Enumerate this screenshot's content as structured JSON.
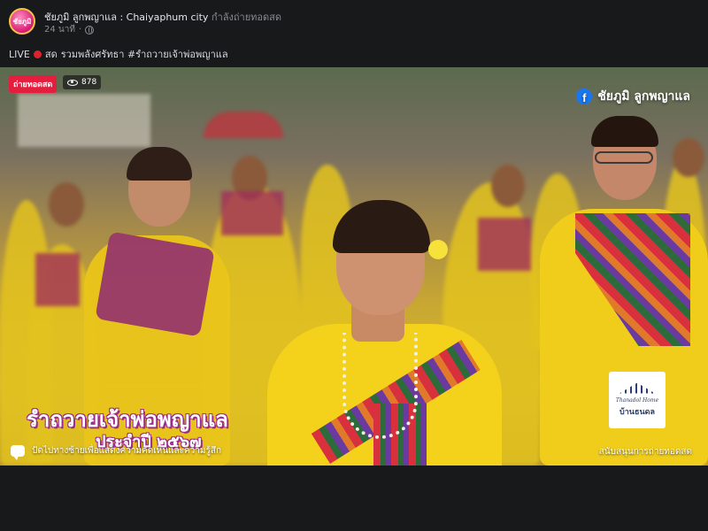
{
  "header": {
    "avatar_text": "ชัยภูมิ",
    "page_name": "ชัยภูมิ ลูกพญาแล : Chaiyaphum city",
    "status": "กำลังถ่ายทอดสด",
    "time": "24 นาที",
    "privacy_icon": "globe-icon"
  },
  "caption": {
    "live_label": "LIVE",
    "live_word": "สด",
    "text": "รวมพลังศรัทธา #รำถวายเจ้าพ่อพญาแล"
  },
  "video": {
    "live_badge": "ถ่ายทอดสด",
    "viewer_count": "878",
    "viewer_icon": "eye-icon",
    "fb_icon": "facebook-icon",
    "page_watermark": "ชัยภูมิ ลูกพญาแล",
    "title_line1": "รำถวายเจ้าพ่อพญาแล",
    "title_line2": "ประจำปี ๒๕๖๗",
    "comment_hint": "ปัดไปทางซ้ายเพื่อแสดงความคิดเห็นและความรู้สึก",
    "sponsor_logo_en": "Thanadol Home",
    "sponsor_logo_th": "บ้านธนดล",
    "sponsor_text": "สนับสนุนการถ่ายทอดสด"
  },
  "colors": {
    "background": "#18191b",
    "live_red": "#e41e3f",
    "facebook_blue": "#1877f2",
    "title_outline": "#9b2a8c"
  }
}
